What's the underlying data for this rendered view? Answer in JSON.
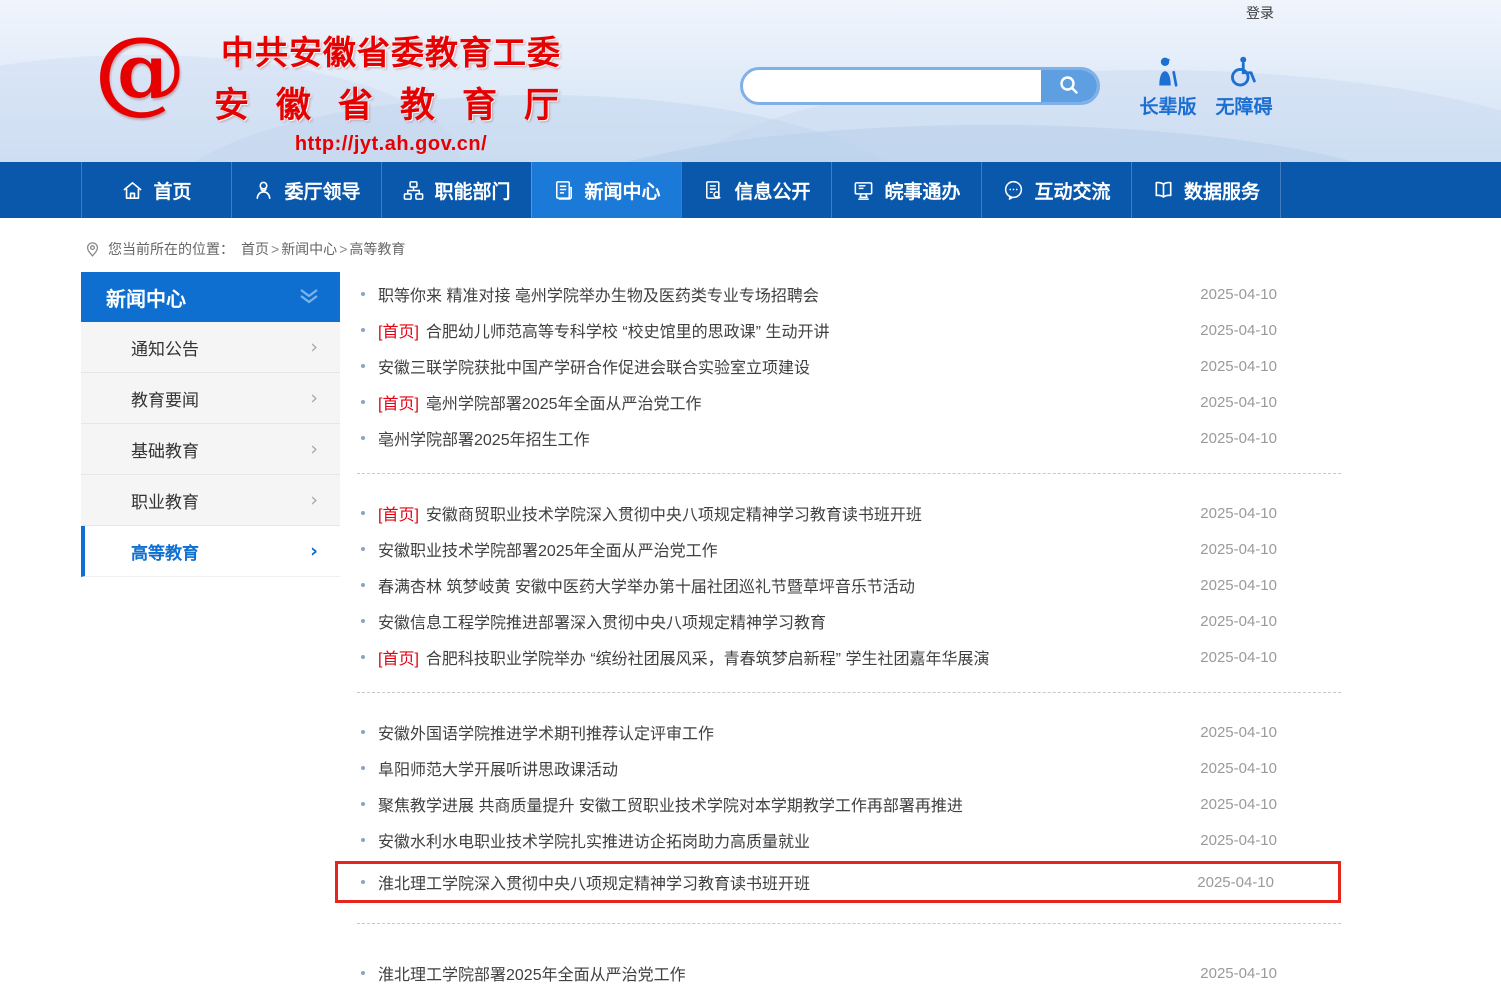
{
  "page": {
    "login_label": "登录"
  },
  "header": {
    "org_line1": "中共安徽省委教育工委",
    "org_line2": "安徽省教育厅",
    "url": "http://jyt.ah.gov.cn/",
    "search": {
      "value": "",
      "placeholder": ""
    },
    "accessibility": [
      {
        "label": "长辈版",
        "icon": "elder-icon"
      },
      {
        "label": "无障碍",
        "icon": "wheelchair-icon"
      }
    ],
    "brand_red": "#e60000",
    "accent_blue": "#1d6fd1"
  },
  "nav": {
    "bg": "#0a58ac",
    "active_bg": "#1b7ad8",
    "items": [
      {
        "id": "home",
        "label": "首页",
        "icon": "home-icon",
        "active": false
      },
      {
        "id": "leaders",
        "label": "委厅领导",
        "icon": "leaders-icon",
        "active": false
      },
      {
        "id": "departments",
        "label": "职能部门",
        "icon": "departments-icon",
        "active": false
      },
      {
        "id": "news-center",
        "label": "新闻中心",
        "icon": "news-icon",
        "active": true
      },
      {
        "id": "info-disclosure",
        "label": "信息公开",
        "icon": "info-disclosure-icon",
        "active": false
      },
      {
        "id": "online-service",
        "label": "皖事通办",
        "icon": "online-service-icon",
        "active": false
      },
      {
        "id": "interaction",
        "label": "互动交流",
        "icon": "interaction-icon",
        "active": false
      },
      {
        "id": "data-service",
        "label": "数据服务",
        "icon": "data-service-icon",
        "active": false
      }
    ]
  },
  "breadcrumb": {
    "prefix": "您当前所在的位置：",
    "path": [
      "首页",
      "新闻中心",
      "高等教育"
    ]
  },
  "sidebar": {
    "title": "新闻中心",
    "items": [
      {
        "id": "notices",
        "label": "通知公告",
        "active": false
      },
      {
        "id": "education-news",
        "label": "教育要闻",
        "active": false
      },
      {
        "id": "basic-education",
        "label": "基础教育",
        "active": false
      },
      {
        "id": "vocational-education",
        "label": "职业教育",
        "active": false
      },
      {
        "id": "higher-education",
        "label": "高等教育",
        "active": true
      }
    ]
  },
  "news": {
    "highlight_color": "#e8251d",
    "groups": [
      {
        "items": [
          {
            "prefix": "",
            "title": "职等你来 精准对接 亳州学院举办生物及医药类专业专场招聘会",
            "date": "2025-04-10",
            "highlighted": false
          },
          {
            "prefix": "[首页]",
            "title": "合肥幼儿师范高等专科学校 “校史馆里的思政课” 生动开讲",
            "date": "2025-04-10",
            "highlighted": false
          },
          {
            "prefix": "",
            "title": "安徽三联学院获批中国产学研合作促进会联合实验室立项建设",
            "date": "2025-04-10",
            "highlighted": false
          },
          {
            "prefix": "[首页]",
            "title": "亳州学院部署2025年全面从严治党工作",
            "date": "2025-04-10",
            "highlighted": false
          },
          {
            "prefix": "",
            "title": "亳州学院部署2025年招生工作",
            "date": "2025-04-10",
            "highlighted": false
          }
        ]
      },
      {
        "items": [
          {
            "prefix": "[首页]",
            "title": "安徽商贸职业技术学院深入贯彻中央八项规定精神学习教育读书班开班",
            "date": "2025-04-10",
            "highlighted": false
          },
          {
            "prefix": "",
            "title": "安徽职业技术学院部署2025年全面从严治党工作",
            "date": "2025-04-10",
            "highlighted": false
          },
          {
            "prefix": "",
            "title": "春满杏林 筑梦岐黄 安徽中医药大学举办第十届社团巡礼节暨草坪音乐节活动",
            "date": "2025-04-10",
            "highlighted": false
          },
          {
            "prefix": "",
            "title": "安徽信息工程学院推进部署深入贯彻中央八项规定精神学习教育",
            "date": "2025-04-10",
            "highlighted": false
          },
          {
            "prefix": "[首页]",
            "title": "合肥科技职业学院举办 “缤纷社团展风采，青春筑梦启新程” 学生社团嘉年华展演",
            "date": "2025-04-10",
            "highlighted": false
          }
        ]
      },
      {
        "items": [
          {
            "prefix": "",
            "title": "安徽外国语学院推进学术期刊推荐认定评审工作",
            "date": "2025-04-10",
            "highlighted": false
          },
          {
            "prefix": "",
            "title": "阜阳师范大学开展听讲思政课活动",
            "date": "2025-04-10",
            "highlighted": false
          },
          {
            "prefix": "",
            "title": "聚焦教学进展 共商质量提升 安徽工贸职业技术学院对本学期教学工作再部署再推进",
            "date": "2025-04-10",
            "highlighted": false
          },
          {
            "prefix": "",
            "title": "安徽水利水电职业技术学院扎实推进访企拓岗助力高质量就业",
            "date": "2025-04-10",
            "highlighted": false
          },
          {
            "prefix": "",
            "title": "淮北理工学院深入贯彻中央八项规定精神学习教育读书班开班",
            "date": "2025-04-10",
            "highlighted": true
          }
        ]
      },
      {
        "items": [
          {
            "prefix": "",
            "title": "淮北理工学院部署2025年全面从严治党工作",
            "date": "2025-04-10",
            "highlighted": false
          }
        ]
      }
    ]
  }
}
